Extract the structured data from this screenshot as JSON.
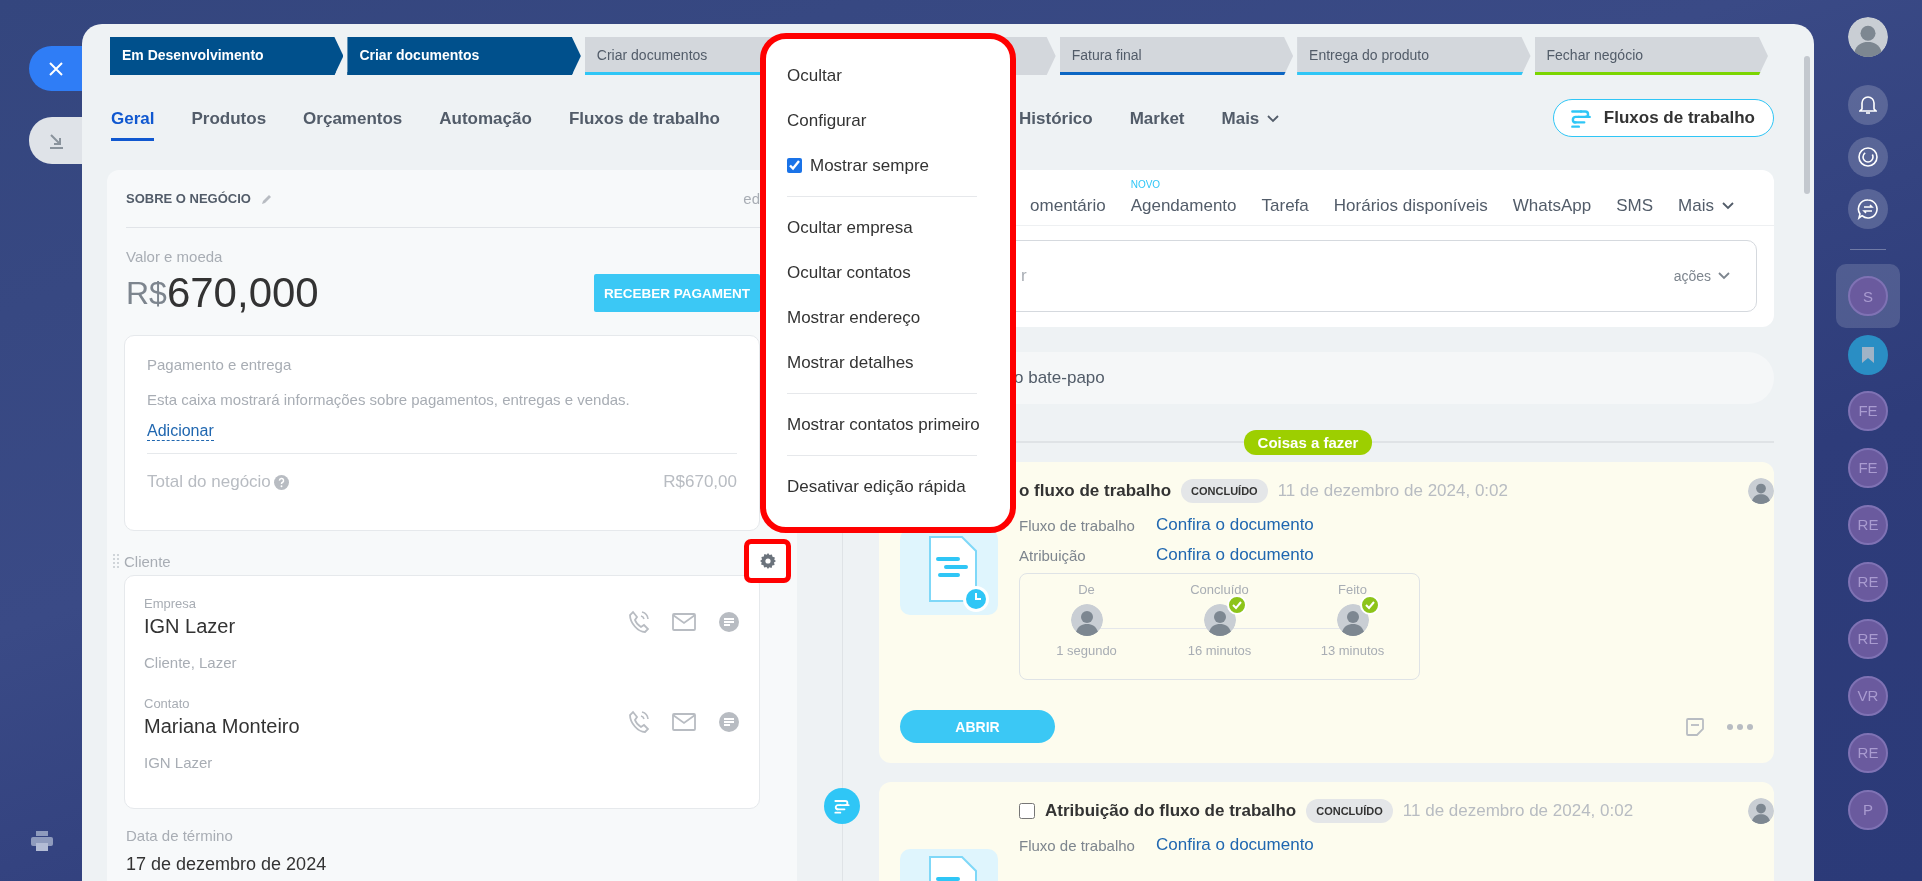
{
  "stages": [
    {
      "label": "Em Desenvolvimento",
      "passed": true,
      "color": "#00508c"
    },
    {
      "label": "Criar documentos",
      "passed": true,
      "color": "#00508c"
    },
    {
      "label": "Criar documentos",
      "passed": false,
      "color": "#2fc6f6"
    },
    {
      "passed": false
    },
    {
      "label": "Fatura final",
      "passed": false,
      "color": "#0b66c3"
    },
    {
      "label": "Entrega do produto",
      "passed": false,
      "color": "#2fc6f6"
    },
    {
      "label": "Fechar negócio",
      "passed": false,
      "color": "#7bd500"
    }
  ],
  "tabs": [
    {
      "label": "Geral",
      "kind": "tab",
      "selected": true
    },
    {
      "label": "Produtos",
      "kind": "tab",
      "selected": false
    },
    {
      "label": "Orçamentos",
      "kind": "tab",
      "selected": false
    },
    {
      "label": "Automação",
      "kind": "tab",
      "selected": false
    },
    {
      "label": "Fluxos de trabalho",
      "kind": "tab",
      "selected": false
    },
    {
      "label": "Histórico",
      "kind": "tab",
      "selected": false
    },
    {
      "label": "Market",
      "kind": "tab",
      "selected": false
    },
    {
      "label": "Mais",
      "kind": "dropdown",
      "selected": false
    }
  ],
  "workflows_button": {
    "label": "Fluxos de trabalho"
  },
  "deal": {
    "title": "SOBRE O NEGÓCIO",
    "edit_link": "ed",
    "amount_label": "Valor e moeda",
    "currency": "R$",
    "amount": "670,000",
    "pay_button": "RECEBER PAGAMENT",
    "payment": {
      "title": "Pagamento e entrega",
      "description": "Esta caixa mostrará informações sobre pagamentos, entregas e vendas.",
      "add_link": "Adicionar",
      "total_label": "Total do negócio",
      "total_value": "R$670,00"
    },
    "client_label": "Cliente",
    "client": [
      {
        "label": "Empresa",
        "name": "IGN Lazer",
        "detail": "Cliente, Lazer"
      },
      {
        "label": "Contato",
        "name": "Mariana Monteiro",
        "detail": "IGN Lazer"
      }
    ],
    "end_date_label": "Data de término",
    "end_date": "17 de dezembro de 2024"
  },
  "menu": [
    {
      "kind": "item",
      "label": "Ocultar"
    },
    {
      "kind": "item",
      "label": "Configurar"
    },
    {
      "kind": "checkbox",
      "label": "Mostrar sempre",
      "checked": true
    },
    {
      "kind": "divider"
    },
    {
      "kind": "item",
      "label": "Ocultar empresa"
    },
    {
      "kind": "item",
      "label": "Ocultar contatos"
    },
    {
      "kind": "item",
      "label": "Mostrar endereço"
    },
    {
      "kind": "item",
      "label": "Mostrar detalhes"
    },
    {
      "kind": "divider"
    },
    {
      "kind": "item",
      "label": "Mostrar contatos primeiro"
    },
    {
      "kind": "divider"
    },
    {
      "kind": "item",
      "label": "Desativar edição rápida"
    }
  ],
  "composer": {
    "tabs": [
      {
        "label": "omentário",
        "kind": "tab"
      },
      {
        "label": "Agendamento",
        "kind": "tab",
        "badge": "NOVO"
      },
      {
        "label": "Tarefa",
        "kind": "tab"
      },
      {
        "label": "Horários disponíveis",
        "kind": "tab"
      },
      {
        "label": "WhatsApp",
        "kind": "tab"
      },
      {
        "label": "SMS",
        "kind": "tab"
      },
      {
        "label": "Mais",
        "kind": "dropdown"
      }
    ],
    "placeholder": "r",
    "actions": "ações"
  },
  "chat_bar": "o bate-papo",
  "todo_label": "Coisas a fazer",
  "activities": [
    {
      "title": "o fluxo de trabalho",
      "status": "CONCLUÍDO",
      "date": "11 de dezembro de 2024, 0:02",
      "rows": [
        {
          "label": "Fluxo de trabalho",
          "link": "Confira o documento"
        },
        {
          "label": "Atribuição",
          "link": "Confira o documento"
        }
      ],
      "steps": [
        {
          "label": "De",
          "time": "1 segundo",
          "done": false
        },
        {
          "label": "Concluído",
          "time": "16 minutos",
          "done": true
        },
        {
          "label": "Feito",
          "time": "13 minutos",
          "done": true
        }
      ],
      "action": "ABRIR"
    },
    {
      "title": "Atribuição do fluxo de trabalho",
      "status": "CONCLUÍDO",
      "date": "11 de dezembro de 2024, 0:02",
      "checked": false,
      "rows": [
        {
          "label": "Fluxo de trabalho",
          "link": "Confira o documento"
        }
      ]
    }
  ],
  "sidebar": [
    {
      "kind": "chat",
      "label": "S",
      "selected": true
    },
    {
      "kind": "bookmark",
      "selected": false
    },
    {
      "kind": "chat",
      "label": "FE",
      "selected": false
    },
    {
      "kind": "chat",
      "label": "FE",
      "selected": false
    },
    {
      "kind": "chat",
      "label": "RE",
      "selected": false
    },
    {
      "kind": "chat",
      "label": "RE",
      "selected": false
    },
    {
      "kind": "chat",
      "label": "RE",
      "selected": false
    },
    {
      "kind": "chat",
      "label": "VR",
      "selected": false
    },
    {
      "kind": "chat",
      "label": "RE",
      "selected": false
    },
    {
      "kind": "chat",
      "label": "P",
      "selected": false
    }
  ]
}
